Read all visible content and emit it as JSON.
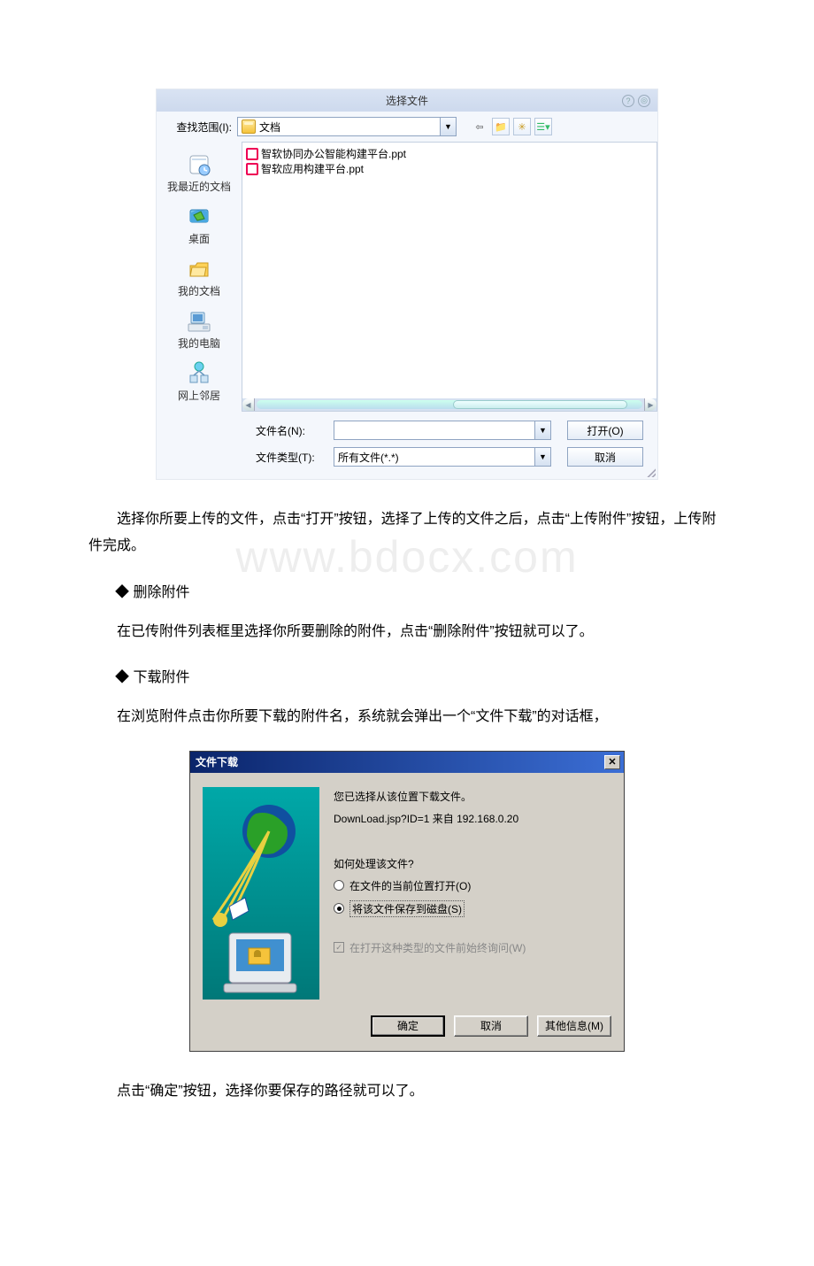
{
  "dialog1": {
    "title": "选择文件",
    "look_in_label": "查找范围(I):",
    "look_in_value": "文档",
    "places": [
      {
        "label": "我最近的文档"
      },
      {
        "label": "桌面"
      },
      {
        "label": "我的文档"
      },
      {
        "label": "我的电脑"
      },
      {
        "label": "网上邻居"
      }
    ],
    "files": [
      "智软协同办公智能构建平台.ppt",
      "智软应用构建平台.ppt"
    ],
    "filename_label": "文件名(N):",
    "filetype_label": "文件类型(T):",
    "filetype_value": "所有文件(*.*)",
    "open_btn": "打开(O)",
    "cancel_btn": "取消"
  },
  "paragraphs": {
    "p1": "选择你所要上传的文件，点击“打开”按钮，选择了上传的文件之后，点击“上传附件”按钮，上传附件完成。",
    "b1": "◆ 删除附件",
    "p2": "在已传附件列表框里选择你所要删除的附件，点击“删除附件”按钮就可以了。",
    "b2": "◆ 下载附件",
    "p3": "在浏览附件点击你所要下载的附件名，系统就会弹出一个“文件下载”的对话框，",
    "p4": "点击“确定”按钮，选择你要保存的路径就可以了。"
  },
  "watermark": "www.bdocx.com",
  "dialog2": {
    "title": "文件下载",
    "line1": "您已选择从该位置下载文件。",
    "line2": "DownLoad.jsp?ID=1 来自 192.168.0.20",
    "question": "如何处理该文件?",
    "radio1": "在文件的当前位置打开(O)",
    "radio2": "将该文件保存到磁盘(S)",
    "checkbox": "在打开这种类型的文件前始终询问(W)",
    "ok": "确定",
    "cancel": "取消",
    "more": "其他信息(M)"
  }
}
